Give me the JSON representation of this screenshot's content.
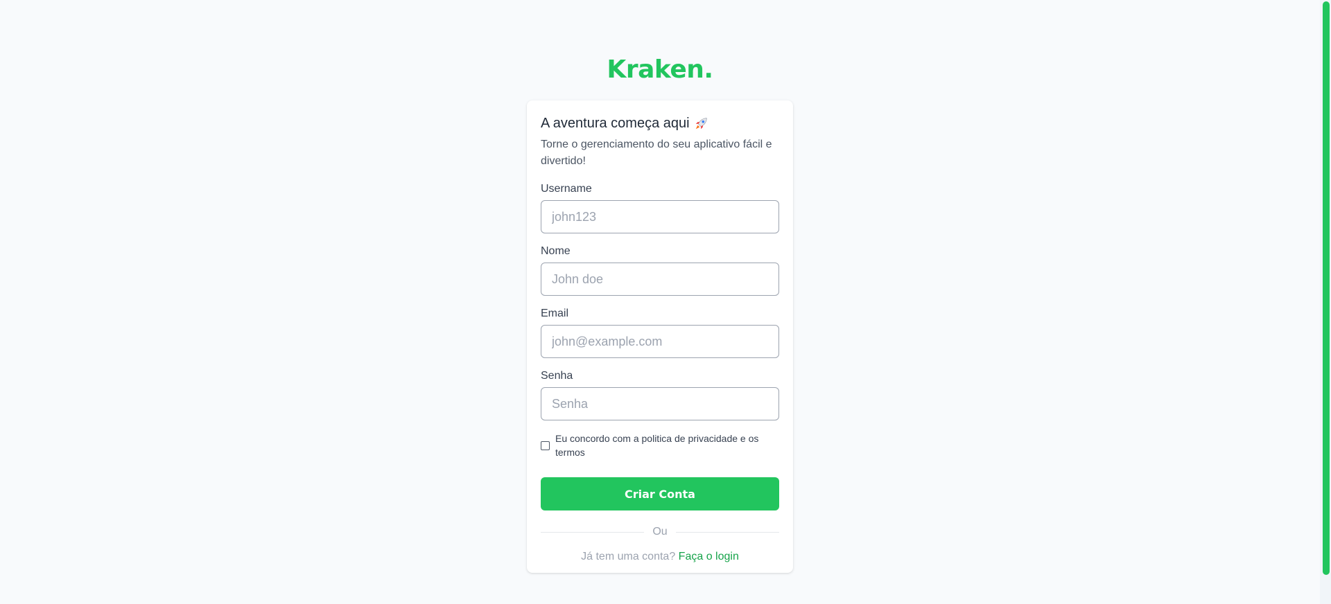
{
  "brand": {
    "logo": "Kraken.",
    "accent": "#22c55e"
  },
  "card": {
    "title": "A aventura começa aqui",
    "title_icon": "rocket-icon",
    "subtitle": "Torne o gerenciamento do seu aplicativo fácil e divertido!"
  },
  "form": {
    "username": {
      "label": "Username",
      "placeholder": "john123",
      "value": ""
    },
    "name": {
      "label": "Nome",
      "placeholder": "John doe",
      "value": ""
    },
    "email": {
      "label": "Email",
      "placeholder": "john@example.com",
      "value": ""
    },
    "password": {
      "label": "Senha",
      "placeholder": "Senha",
      "value": ""
    },
    "terms_label": "Eu concordo com a politica de privacidade e os termos",
    "terms_checked": false,
    "submit_label": "Criar Conta"
  },
  "divider_text": "Ou",
  "login": {
    "prompt": "Já tem uma conta?",
    "link_label": "Faça o login"
  }
}
